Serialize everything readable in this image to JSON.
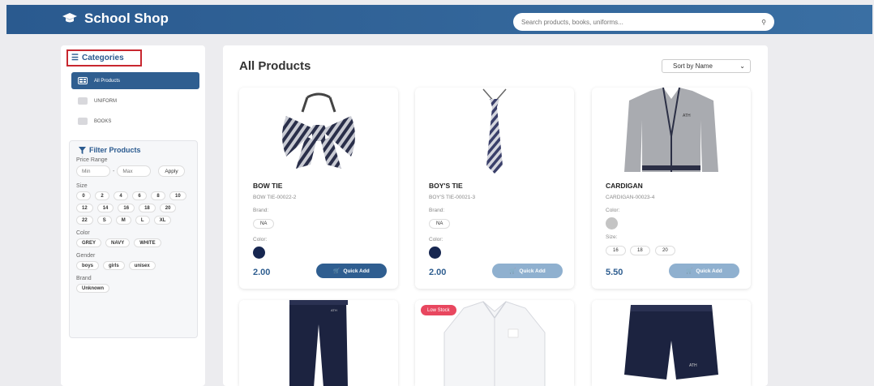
{
  "header": {
    "brand": "School Shop",
    "search_placeholder": "Search products, books, uniforms..."
  },
  "sidebar": {
    "title": "Categories",
    "categories": [
      {
        "label": "All Products",
        "active": true
      },
      {
        "label": "UNIFORM",
        "active": false
      },
      {
        "label": "BOOKS",
        "active": false
      }
    ],
    "filter": {
      "title": "Filter Products",
      "price_label": "Price Range",
      "min_placeholder": "Min",
      "max_placeholder": "Max",
      "apply_label": "Apply",
      "size_label": "Size",
      "sizes": [
        "0",
        "2",
        "4",
        "6",
        "8",
        "10",
        "12",
        "14",
        "16",
        "18",
        "20",
        "22",
        "S",
        "M",
        "L",
        "XL"
      ],
      "color_label": "Color",
      "colors": [
        "GREY",
        "NAVY",
        "WHITE"
      ],
      "gender_label": "Gender",
      "genders": [
        "boys",
        "girls",
        "unisex"
      ],
      "brand_label": "Brand",
      "brands": [
        "Unknown"
      ]
    }
  },
  "main": {
    "title": "All Products",
    "sort_label": "Sort by Name",
    "quick_add_label": "Quick Add",
    "products": [
      {
        "name": "BOW TIE",
        "sku": "BOW TIE-00022-2",
        "brand_label": "Brand:",
        "brand": "NA",
        "color_label": "Color:",
        "color": "#162650",
        "price": "2.00",
        "button_color": "#2f5e90"
      },
      {
        "name": "BOY'S TIE",
        "sku": "BOY'S TIE-00021-3",
        "brand_label": "Brand:",
        "brand": "NA",
        "color_label": "Color:",
        "color": "#162650",
        "price": "2.00",
        "button_color": "#8fb0cf"
      },
      {
        "name": "CARDIGAN",
        "sku": "CARDIGAN-00023-4",
        "color_label": "Color:",
        "color": "#c4c4c4",
        "size_label": "Size:",
        "sizes": [
          "16",
          "18",
          "20"
        ],
        "price": "5.50",
        "button_color": "#8fb0cf"
      }
    ],
    "low_stock_label": "Low Stock"
  }
}
